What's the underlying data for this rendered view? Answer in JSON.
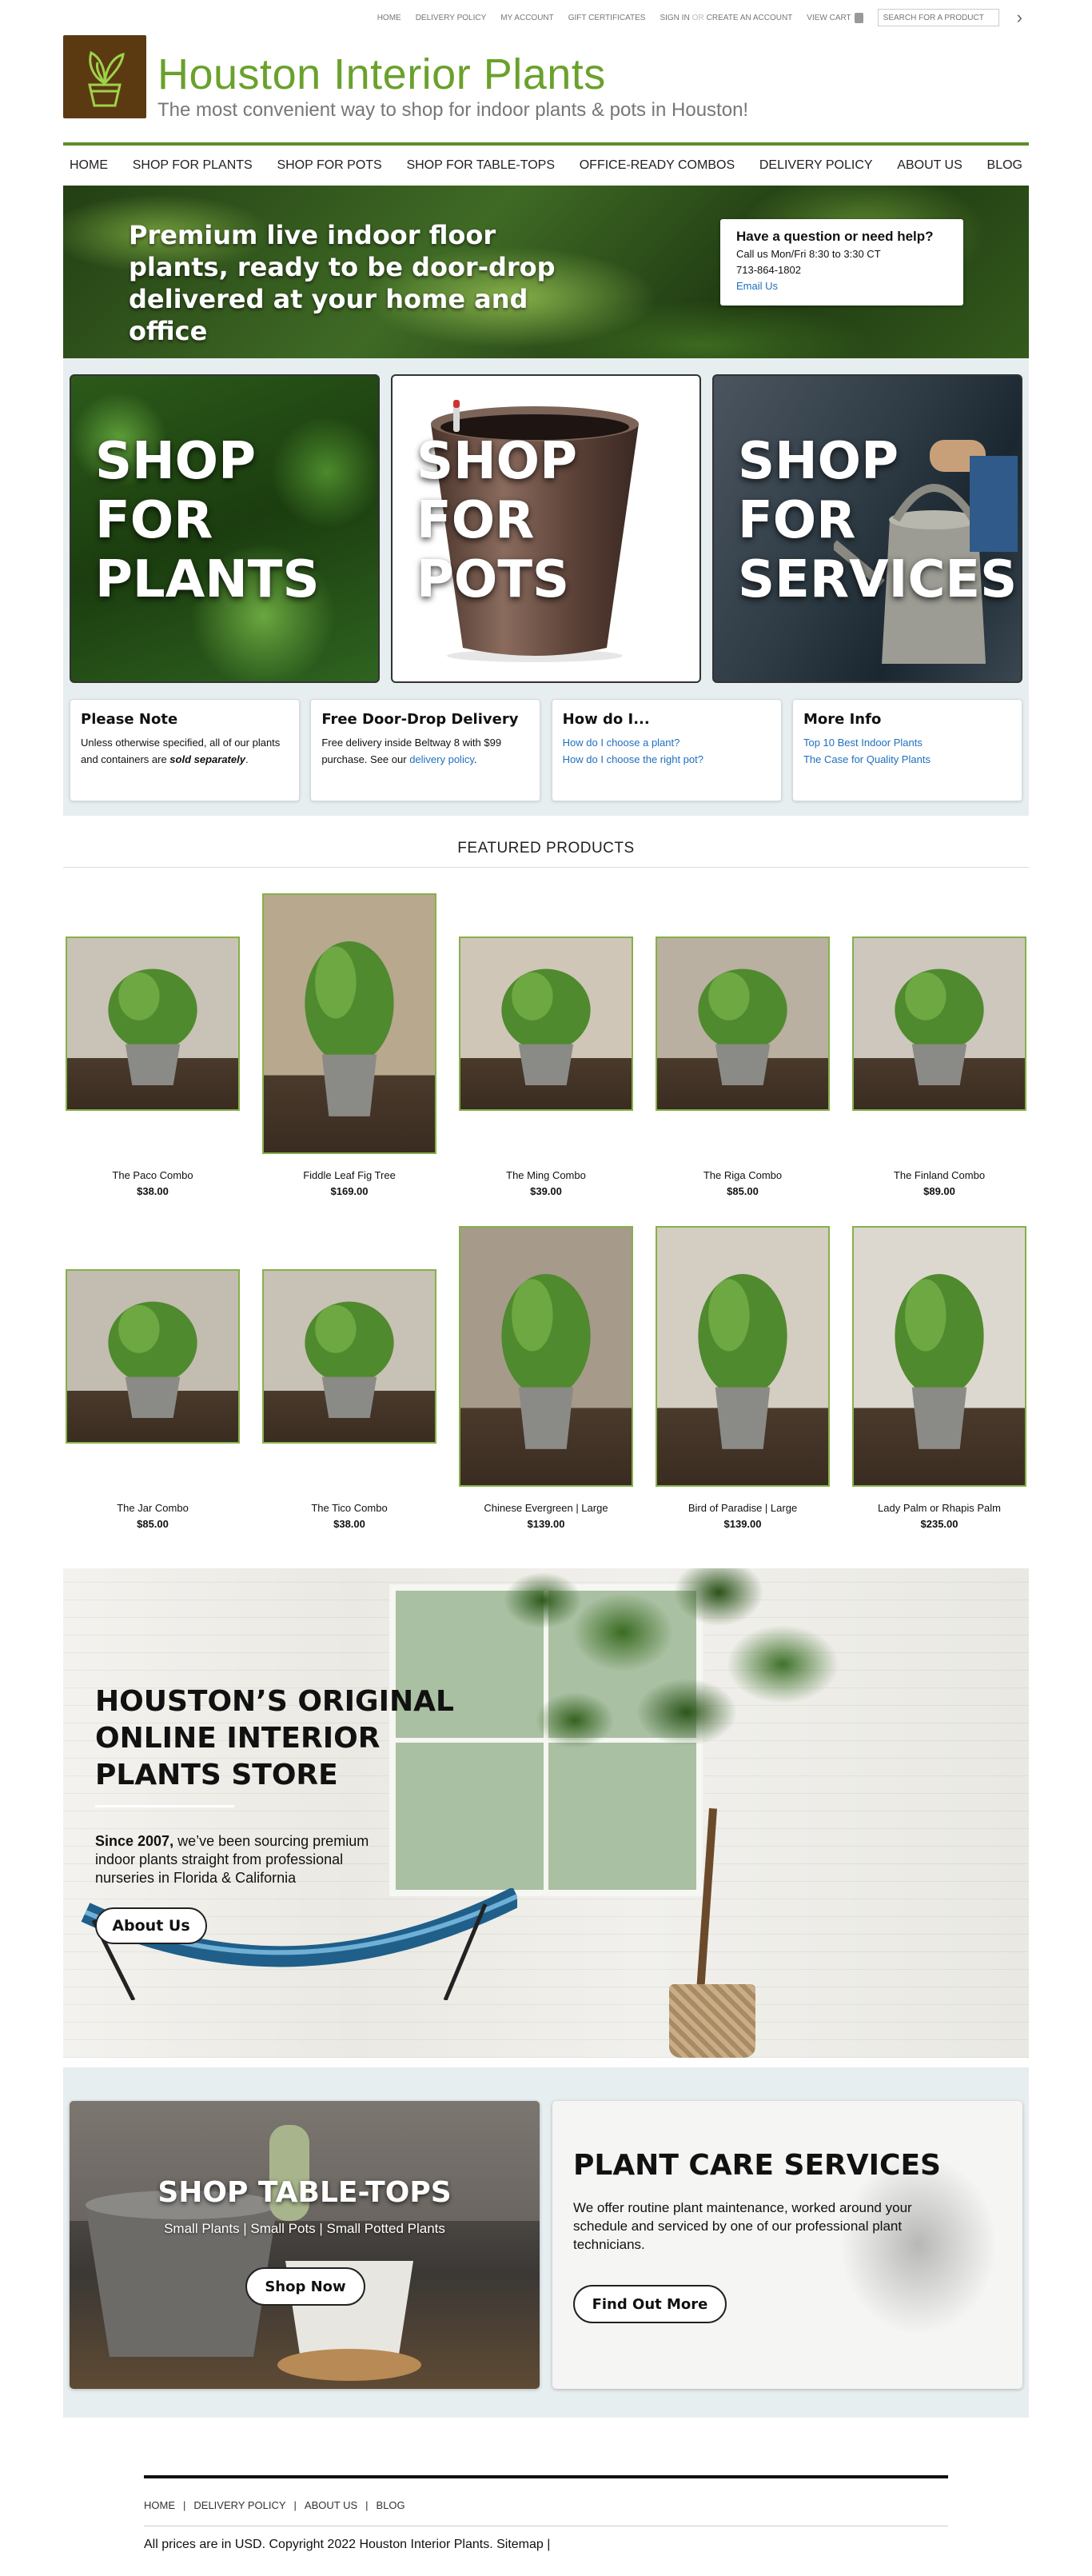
{
  "util": {
    "home": "HOME",
    "delivery": "DELIVERY POLICY",
    "account": "MY ACCOUNT",
    "gift": "GIFT CERTIFICATES",
    "signin": "SIGN IN",
    "or": "OR",
    "create": "CREATE AN ACCOUNT",
    "cart": "VIEW CART",
    "search_placeholder": "SEARCH FOR A PRODUCT"
  },
  "header": {
    "brand": "Houston Interior Plants",
    "tagline": "The most convenient way to shop for indoor plants & pots in Houston!"
  },
  "nav": [
    "HOME",
    "SHOP FOR PLANTS",
    "SHOP FOR POTS",
    "SHOP FOR TABLE-TOPS",
    "OFFICE-READY COMBOS",
    "DELIVERY POLICY",
    "ABOUT US",
    "BLOG"
  ],
  "hero": {
    "headline": "Premium live indoor floor plants, ready to be door-drop delivered at your home and office",
    "help_title": "Have a question or need help?",
    "help_hours": "Call us Mon/Fri 8:30 to 3:30 CT",
    "help_phone": "713-864-1802",
    "help_email": "Email Us"
  },
  "shops": [
    {
      "label": "SHOP\nFOR\nPLANTS"
    },
    {
      "label": "SHOP\nFOR\nPOTS"
    },
    {
      "label": "SHOP\nFOR\nSERVICES"
    }
  ],
  "info": {
    "note_title": "Please Note",
    "note_text": "Unless otherwise specified, all of our plants and containers are ",
    "note_em": "sold separately",
    "note_end": ".",
    "delivery_title": "Free Door-Drop Delivery",
    "delivery_text": "Free delivery inside Beltway 8 with $99 purchase. See our ",
    "delivery_link": "delivery policy",
    "delivery_end": ".",
    "how_title": "How do I...",
    "how_links": [
      "How do I choose a plant?",
      "How do I choose the right pot?"
    ],
    "more_title": "More Info",
    "more_links": [
      "Top 10 Best Indoor Plants",
      "The Case for Quality Plants"
    ]
  },
  "featured": {
    "title": "FEATURED PRODUCTS",
    "products": [
      {
        "name": "The Paco Combo",
        "price": "$38.00"
      },
      {
        "name": "Fiddle Leaf Fig Tree",
        "price": "$169.00"
      },
      {
        "name": "The Ming Combo",
        "price": "$39.00"
      },
      {
        "name": "The Riga Combo",
        "price": "$85.00"
      },
      {
        "name": "The Finland Combo",
        "price": "$89.00"
      },
      {
        "name": "The Jar Combo",
        "price": "$85.00"
      },
      {
        "name": "The Tico Combo",
        "price": "$38.00"
      },
      {
        "name": "Chinese Evergreen | Large",
        "price": "$139.00"
      },
      {
        "name": "Bird of Paradise | Large",
        "price": "$139.00"
      },
      {
        "name": "Lady Palm or Rhapis Palm",
        "price": "$235.00"
      }
    ]
  },
  "story": {
    "title": "HOUSTON’S ORIGINAL ONLINE INTERIOR PLANTS STORE",
    "lead": "Since 2007,",
    "text": " we’ve been sourcing premium indoor plants straight from professional nurseries in Florida & California",
    "button": "About Us"
  },
  "promo": {
    "tt_title": "SHOP TABLE-TOPS",
    "tt_sub": "Small Plants | Small Pots | Small Potted Plants",
    "tt_button": "Shop Now",
    "pc_title": "PLANT CARE SERVICES",
    "pc_text": "We offer routine plant maintenance, worked around your schedule and serviced by one of our professional plant technicians.",
    "pc_button": "Find Out More"
  },
  "footer": {
    "links": [
      "HOME",
      "DELIVERY POLICY",
      "ABOUT US",
      "BLOG"
    ],
    "copyright": "All prices are in USD. Copyright 2022 Houston Interior Plants. Sitemap |"
  },
  "colors": {
    "brand_green": "#6aa12c",
    "nav_rule": "#5e8d2a",
    "link_blue": "#1f6fbf",
    "band_bg": "#e7eef0"
  }
}
